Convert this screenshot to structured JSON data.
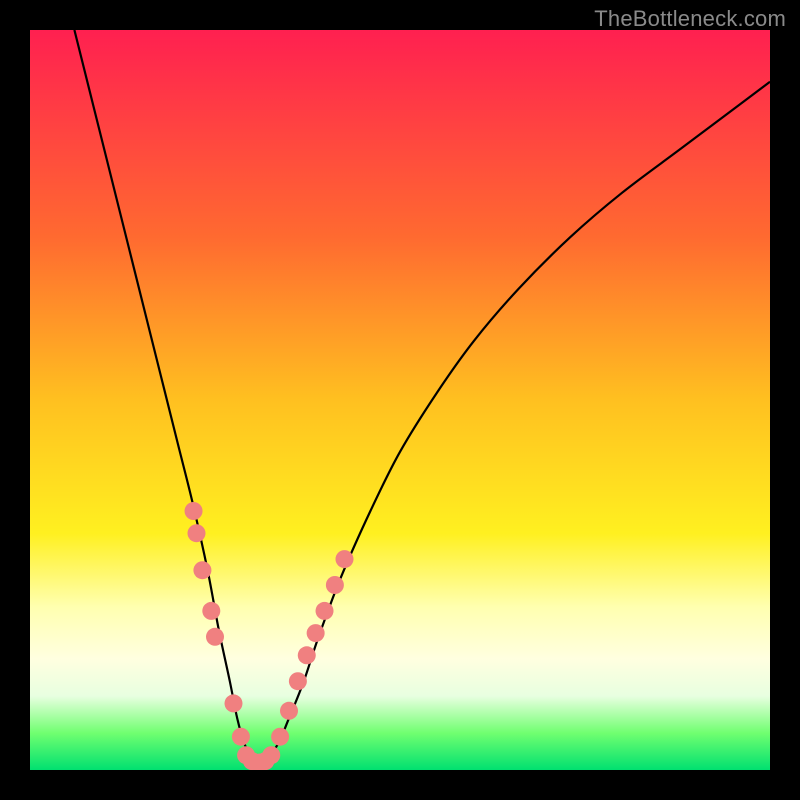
{
  "watermark": "TheBottleneck.com",
  "colors": {
    "page_bg": "#000000",
    "gradient_top": "#ff2050",
    "gradient_bottom": "#00e070",
    "curve": "#000000",
    "marker": "#f08080"
  },
  "chart_data": {
    "type": "line",
    "title": "",
    "xlabel": "",
    "ylabel": "",
    "xlim": [
      0,
      100
    ],
    "ylim": [
      0,
      100
    ],
    "legend": false,
    "grid": false,
    "series": [
      {
        "name": "curve",
        "x": [
          6,
          8,
          10,
          12,
          14,
          16,
          18,
          20,
          22,
          24,
          25.5,
          27,
          28,
          29,
          30,
          31,
          32,
          33.5,
          35,
          37,
          39,
          42,
          46,
          50,
          55,
          60,
          66,
          73,
          80,
          88,
          96,
          100
        ],
        "y": [
          100,
          92,
          84,
          76,
          68,
          60,
          52,
          44,
          36,
          27,
          19,
          12,
          7,
          3.5,
          1.6,
          1.0,
          1.6,
          3.5,
          7,
          12,
          18,
          26,
          35,
          43,
          51,
          58,
          65,
          72,
          78,
          84,
          90,
          93
        ]
      }
    ],
    "markers": [
      {
        "x": 22.1,
        "y": 35.0
      },
      {
        "x": 22.5,
        "y": 32.0
      },
      {
        "x": 23.3,
        "y": 27.0
      },
      {
        "x": 24.5,
        "y": 21.5
      },
      {
        "x": 25.0,
        "y": 18.0
      },
      {
        "x": 27.5,
        "y": 9.0
      },
      {
        "x": 28.5,
        "y": 4.5
      },
      {
        "x": 29.2,
        "y": 2.0
      },
      {
        "x": 30.0,
        "y": 1.2
      },
      {
        "x": 31.0,
        "y": 1.0
      },
      {
        "x": 31.8,
        "y": 1.2
      },
      {
        "x": 32.6,
        "y": 2.0
      },
      {
        "x": 33.8,
        "y": 4.5
      },
      {
        "x": 35.0,
        "y": 8.0
      },
      {
        "x": 36.2,
        "y": 12.0
      },
      {
        "x": 37.4,
        "y": 15.5
      },
      {
        "x": 38.6,
        "y": 18.5
      },
      {
        "x": 39.8,
        "y": 21.5
      },
      {
        "x": 41.2,
        "y": 25.0
      },
      {
        "x": 42.5,
        "y": 28.5
      }
    ]
  }
}
